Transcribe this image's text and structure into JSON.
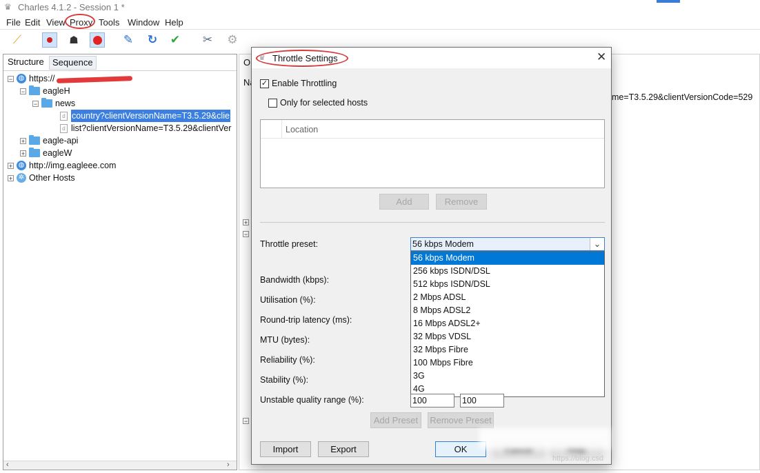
{
  "window": {
    "title": "Charles 4.1.2 - Session 1 *"
  },
  "menu": [
    "File",
    "Edit",
    "View",
    "Proxy",
    "Tools",
    "Window",
    "Help"
  ],
  "toolbar": {
    "icons": [
      "broom-icon",
      "record-icon",
      "turtle-throttle-icon",
      "breakpoint-icon",
      "pen-icon",
      "refresh-icon",
      "checkmark-icon",
      "tools-icon",
      "settings-gear-icon"
    ]
  },
  "left_panel": {
    "tabs": [
      "Structure",
      "Sequence"
    ],
    "tree": [
      {
        "text": "https://",
        "level": 0,
        "kind": "globe",
        "expander": "⊟"
      },
      {
        "text": "eagleH",
        "level": 1,
        "kind": "folder",
        "expander": "⊟"
      },
      {
        "text": "news",
        "level": 2,
        "kind": "folder",
        "expander": "⊟"
      },
      {
        "text": "country?clientVersionName=T3.5.29&clie",
        "level": 3,
        "kind": "file",
        "selected": true
      },
      {
        "text": "list?clientVersionName=T3.5.29&clientVer",
        "level": 3,
        "kind": "file"
      },
      {
        "text": "eagle-api",
        "level": 1,
        "kind": "folder",
        "expander": "⊞"
      },
      {
        "text": "eagleW",
        "level": 1,
        "kind": "folder",
        "expander": "⊞"
      },
      {
        "text": "http://img.eagleee.com",
        "level": 0,
        "kind": "globe",
        "expander": "⊞"
      },
      {
        "text": "Other Hosts",
        "level": 0,
        "kind": "gear",
        "expander": "⊞"
      }
    ]
  },
  "right_panel": {
    "tab_partial": "O",
    "col_partial": "Na",
    "url_fragment": "me=T3.5.29&clientVersionCode=529"
  },
  "dialog": {
    "title": "Throttle Settings",
    "enable_throttling": {
      "label": "Enable Throttling",
      "checked": true
    },
    "only_selected_hosts": {
      "label": "Only for selected hosts",
      "checked": false
    },
    "location_header": "Location",
    "add_label": "Add",
    "remove_label": "Remove",
    "preset_label": "Throttle preset:",
    "preset_value": "56 kbps Modem",
    "preset_options": [
      "56 kbps Modem",
      "256 kbps ISDN/DSL",
      "512 kbps ISDN/DSL",
      "2 Mbps ADSL",
      "8 Mbps ADSL2",
      "16 Mbps ADSL2+",
      "32 Mbps VDSL",
      "32 Mbps Fibre",
      "100 Mbps Fibre",
      "3G",
      "4G"
    ],
    "fields": {
      "bandwidth": "Bandwidth (kbps):",
      "utilisation": "Utilisation (%):",
      "latency": "Round-trip latency (ms):",
      "mtu": "MTU (bytes):",
      "reliability": "Reliability (%):",
      "stability": "Stability (%):",
      "unstable_range": "Unstable quality range (%):"
    },
    "unstable_min": "100",
    "unstable_max": "100",
    "add_preset_label": "Add Preset",
    "remove_preset_label": "Remove Preset",
    "import_label": "Import",
    "export_label": "Export",
    "ok_label": "OK",
    "cancel_label": "Cancel",
    "help_label": "Help",
    "watermark": "https://blog.csd"
  },
  "colors": {
    "selection": "#3b7fe0",
    "dropdown_selected": "#0078d7",
    "annotation": "#d63a3a"
  }
}
